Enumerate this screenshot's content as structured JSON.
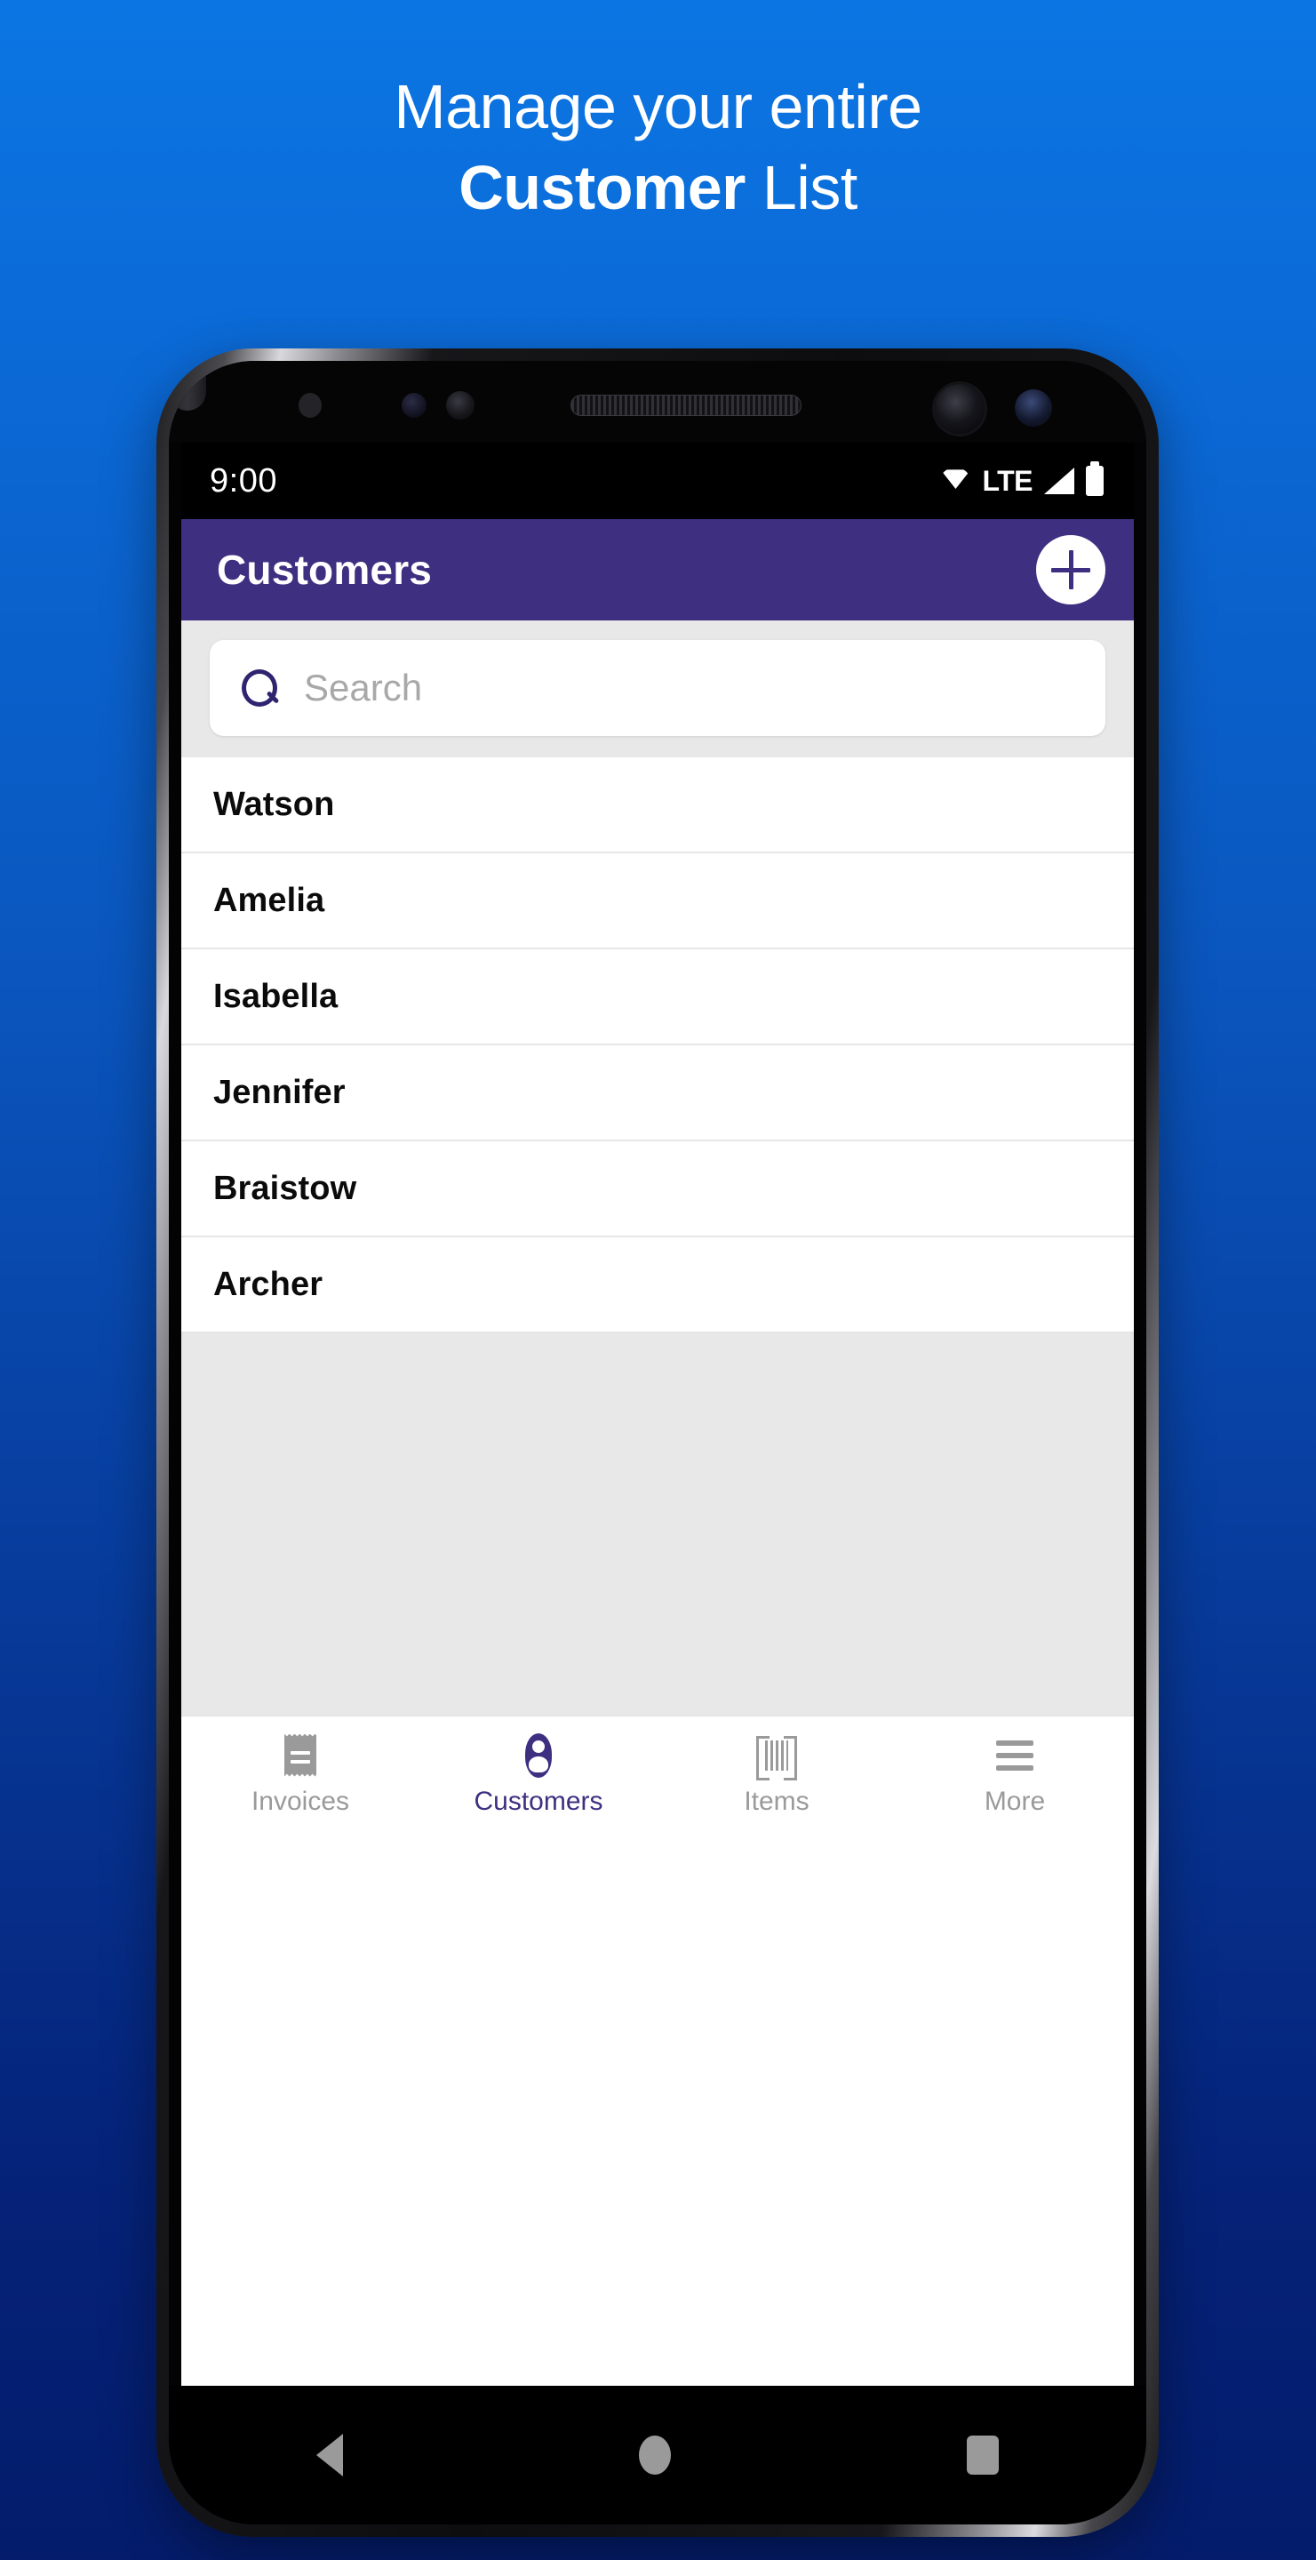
{
  "promo": {
    "line1": "Manage your entire",
    "line2_bold": "Customer",
    "line2_rest": " List"
  },
  "colors": {
    "bg_top": "#0b76e3",
    "bg_bottom": "#041c6b",
    "appbar": "#3f2f80",
    "accent": "#3f2f80",
    "inactive": "#9a9a9a",
    "panel": "#e8e8e8"
  },
  "statusbar": {
    "time": "9:00",
    "network_label": "LTE",
    "icons": [
      "wifi-icon",
      "signal-icon",
      "battery-icon"
    ]
  },
  "appbar": {
    "title": "Customers",
    "add_button": "+"
  },
  "search": {
    "placeholder": "Search",
    "value": "",
    "icon": "search-icon"
  },
  "customers": [
    {
      "name": "Watson"
    },
    {
      "name": "Amelia"
    },
    {
      "name": "Isabella"
    },
    {
      "name": "Jennifer"
    },
    {
      "name": "Braistow"
    },
    {
      "name": "Archer"
    }
  ],
  "bottom_nav": {
    "active_index": 1,
    "items": [
      {
        "label": "Invoices",
        "icon": "receipt-icon"
      },
      {
        "label": "Customers",
        "icon": "person-icon"
      },
      {
        "label": "Items",
        "icon": "barcode-icon"
      },
      {
        "label": "More",
        "icon": "hamburger-menu-icon"
      }
    ]
  },
  "android_nav": {
    "back": "back-triangle-icon",
    "home": "home-circle-icon",
    "recents": "recents-square-icon"
  }
}
